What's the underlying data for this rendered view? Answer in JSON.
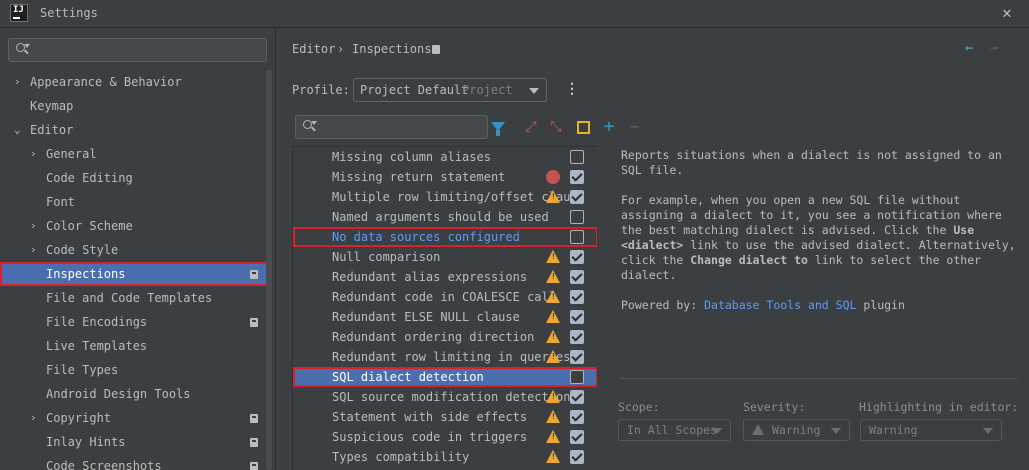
{
  "window": {
    "title": "Settings",
    "logo_text": "IJ",
    "close_glyph": "✕"
  },
  "sidebar": {
    "items": [
      {
        "label": "Appearance & Behavior",
        "arrow": "›",
        "level": 0
      },
      {
        "label": "Keymap",
        "arrow": "",
        "level": 0
      },
      {
        "label": "Editor",
        "arrow": "⌄",
        "level": 0
      },
      {
        "label": "General",
        "arrow": "›",
        "level": 1
      },
      {
        "label": "Code Editing",
        "arrow": "",
        "level": 1
      },
      {
        "label": "Font",
        "arrow": "",
        "level": 1
      },
      {
        "label": "Color Scheme",
        "arrow": "›",
        "level": 1
      },
      {
        "label": "Code Style",
        "arrow": "›",
        "level": 1
      },
      {
        "label": "Inspections",
        "arrow": "",
        "level": 1,
        "selected": true,
        "project_icon": true
      },
      {
        "label": "File and Code Templates",
        "arrow": "",
        "level": 1
      },
      {
        "label": "File Encodings",
        "arrow": "",
        "level": 1,
        "project_icon": true
      },
      {
        "label": "Live Templates",
        "arrow": "",
        "level": 1
      },
      {
        "label": "File Types",
        "arrow": "",
        "level": 1
      },
      {
        "label": "Android Design Tools",
        "arrow": "",
        "level": 1
      },
      {
        "label": "Copyright",
        "arrow": "›",
        "level": 1,
        "project_icon": true
      },
      {
        "label": "Inlay Hints",
        "arrow": "",
        "level": 1,
        "project_icon": true
      },
      {
        "label": "Code Screenshots",
        "arrow": "",
        "level": 1,
        "project_icon": true
      }
    ]
  },
  "header": {
    "breadcrumb_parent": "Editor",
    "breadcrumb_separator": "›",
    "breadcrumb_current": "Inspections",
    "back_glyph": "←",
    "forward_glyph": "→"
  },
  "profile": {
    "label": "Profile:",
    "value": "Project Default",
    "scope": "Project",
    "more_glyph": "⋮"
  },
  "toolbar": {
    "expand_glyph": "⤢",
    "collapse_glyph": "⤡",
    "add_glyph": "+",
    "remove_glyph": "−"
  },
  "inspections": [
    {
      "name": "Missing column aliases",
      "severity": "none",
      "checked": false
    },
    {
      "name": "Missing return statement",
      "severity": "error",
      "checked": true
    },
    {
      "name": "Multiple row limiting/offset clause",
      "severity": "warning",
      "checked": true
    },
    {
      "name": "Named arguments should be used",
      "severity": "none",
      "checked": false
    },
    {
      "name": "No data sources configured",
      "severity": "none",
      "checked": false,
      "highlight": "outline",
      "link": true
    },
    {
      "name": "Null comparison",
      "severity": "warning",
      "checked": true
    },
    {
      "name": "Redundant alias expressions",
      "severity": "warning",
      "checked": true
    },
    {
      "name": "Redundant code in COALESCE call",
      "severity": "warning",
      "checked": true
    },
    {
      "name": "Redundant ELSE NULL clause",
      "severity": "warning",
      "checked": true
    },
    {
      "name": "Redundant ordering direction",
      "severity": "warning",
      "checked": true
    },
    {
      "name": "Redundant row limiting in queries",
      "severity": "warning",
      "checked": true
    },
    {
      "name": "SQL dialect detection",
      "severity": "none",
      "checked": false,
      "highlight": "selected"
    },
    {
      "name": "SQL source modification detection",
      "severity": "warning",
      "checked": true
    },
    {
      "name": "Statement with side effects",
      "severity": "warning",
      "checked": true
    },
    {
      "name": "Suspicious code in triggers",
      "severity": "warning",
      "checked": true
    },
    {
      "name": "Types compatibility",
      "severity": "warning",
      "checked": true
    }
  ],
  "description": {
    "line1": "Reports situations when a dialect is not assigned to an SQL file.",
    "p2_a": "For example, when you open a new SQL file without assigning a dialect to it, you see a notification where the best matching dialect is advised. Click the ",
    "p2_b": "Use <dialect>",
    "p2_c": " link to use the advised dialect. Alternatively, click the ",
    "p2_d": "Change dialect to",
    "p2_e": " link to select the other dialect.",
    "powered_prefix": "Powered by: ",
    "powered_link": "Database Tools and SQL",
    "powered_suffix": " plugin"
  },
  "options": {
    "scope_label": "Scope:",
    "scope_value": "In All Scopes",
    "severity_label": "Severity:",
    "severity_value": "Warning",
    "highlight_label": "Highlighting in editor:",
    "highlight_value": "Warning"
  },
  "colors": {
    "selection": "#4b6eaf",
    "annotation_red": "#d9212c",
    "warning": "#f0a732",
    "link": "#589df6"
  }
}
